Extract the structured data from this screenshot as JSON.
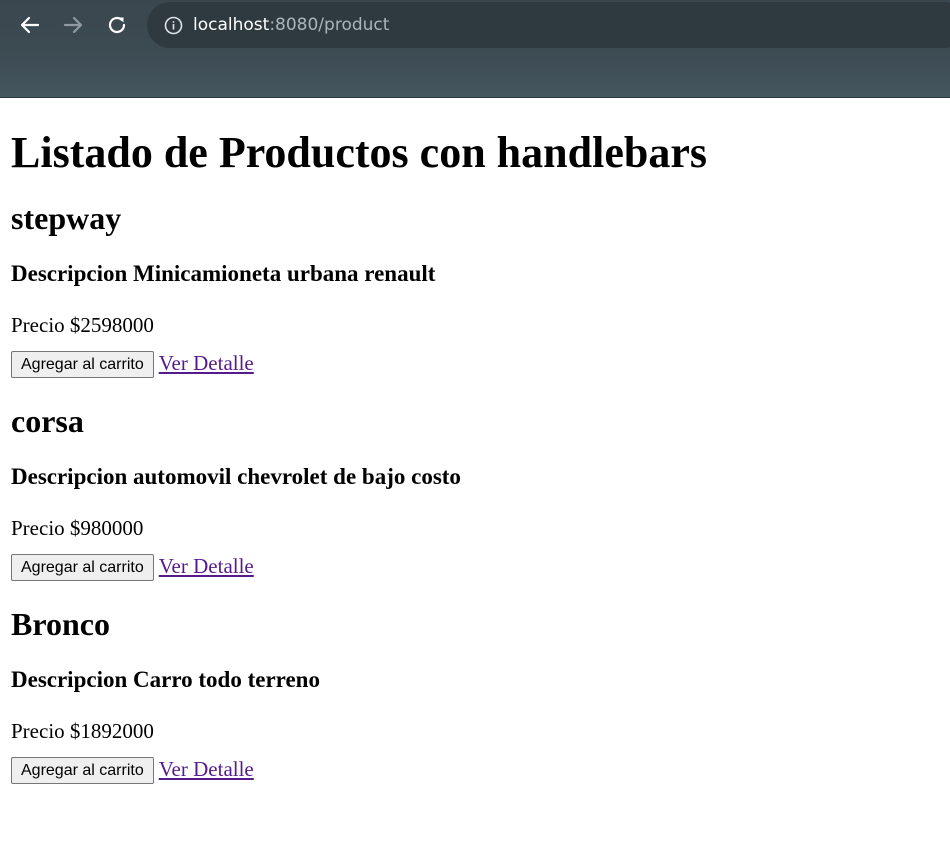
{
  "browser": {
    "url_host": "localhost",
    "url_rest": ":8080/product"
  },
  "page": {
    "title": "Listado de Productos con handlebars"
  },
  "products": [
    {
      "name": "stepway",
      "description": "Descripcion Minicamioneta urbana renault",
      "price": "Precio $2598000",
      "cart_label": "Agregar al carrito",
      "detail_label": "Ver Detalle"
    },
    {
      "name": "corsa",
      "description": "Descripcion automovil chevrolet de bajo costo",
      "price": "Precio $980000",
      "cart_label": "Agregar al carrito",
      "detail_label": "Ver Detalle"
    },
    {
      "name": "Bronco",
      "description": "Descripcion Carro todo terreno",
      "price": "Precio $1892000",
      "cart_label": "Agregar al carrito",
      "detail_label": "Ver Detalle"
    }
  ],
  "colors": {
    "chrome_bg": "#3c4a52",
    "link_visited": "#551a8b"
  }
}
